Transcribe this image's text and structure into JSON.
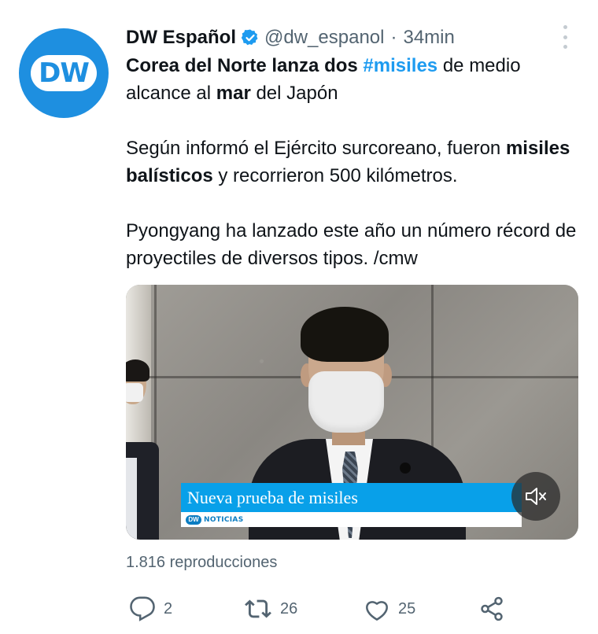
{
  "author": {
    "name": "DW Español",
    "handle": "@dw_espanol",
    "separator": "·",
    "time": "34min",
    "avatar_text": "DW",
    "verified": true
  },
  "tweet": {
    "p1": {
      "bold1": "Corea del Norte lanza dos",
      "hashtag": "#misiles",
      "text1": "de medio alcance al",
      "bold2": "mar",
      "text2": "del Japón"
    },
    "p2": {
      "text1": "Según informó el Ejército surcoreano, fueron",
      "bold1": "misiles balísticos",
      "text2": "y recorrieron 500 kilómetros."
    },
    "p3": {
      "text1": "Pyongyang ha lanzado este año un número récord de proyectiles de diversos tipos. /cmw"
    }
  },
  "media": {
    "lower_third_title": "Nueva prueba de misiles",
    "lower_third_logo": "DW",
    "lower_third_sub": "NOTICIAS",
    "mute_icon": "speaker-muted-icon"
  },
  "stats": {
    "views": "1.816 reproducciones"
  },
  "actions": {
    "reply_count": "2",
    "retweet_count": "26",
    "like_count": "25"
  },
  "colors": {
    "accent": "#1d9bf0",
    "secondary_text": "#536471",
    "dw_blue": "#1e8fe0",
    "lower_third": "#08a0e9"
  }
}
